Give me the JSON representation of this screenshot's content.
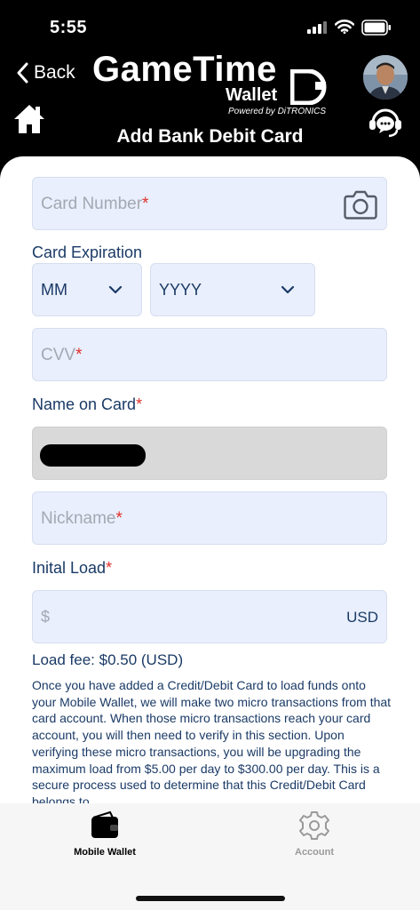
{
  "status_bar": {
    "time": "5:55"
  },
  "header": {
    "back_label": "Back",
    "logo_main": "GameTime",
    "logo_sub": "Wallet",
    "logo_powered": "Powered by DiTRONICS",
    "title": "Add Bank Debit Card"
  },
  "form": {
    "card_number_placeholder": "Card Number",
    "required_mark": "*",
    "expiration_label": "Card Expiration",
    "month_value": "MM",
    "year_value": "YYYY",
    "cvv_placeholder": "CVV",
    "name_label": "Name on Card",
    "nickname_placeholder": "Nickname",
    "initial_load_label": "Inital Load",
    "currency_symbol": "$",
    "currency_code": "USD",
    "load_fee": "Load fee: $0.50 (USD)",
    "description": "Once you have added a Credit/Debit Card to load funds onto your Mobile Wallet, we will make two micro transactions from that card account. When those micro transactions reach your card account, you will then need to verify in this section. Upon verifying these micro transactions, you will be upgrading the maximum load from $5.00 per day to $300.00 per day. This is a secure process used to determine that this Credit/Debit Card belongs to"
  },
  "tabs": {
    "wallet_label": "Mobile Wallet",
    "account_label": "Account"
  },
  "colors": {
    "accent_text": "#1a3a66",
    "field_background": "#e9effc",
    "required": "#e0302a",
    "active_tab": "#000000",
    "inactive_tab": "#9a9a9a"
  }
}
